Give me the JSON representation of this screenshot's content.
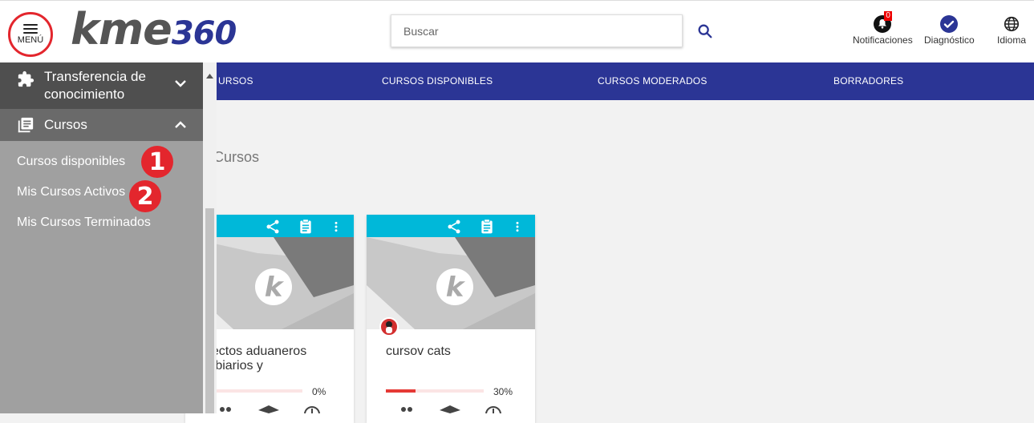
{
  "header": {
    "menu_label": "MENÚ",
    "logo_kme": "kme",
    "logo_360": "360",
    "search_placeholder": "Buscar",
    "notifications_label": "Notificaciones",
    "notifications_count": "0",
    "diagnostic_label": "Diagnóstico",
    "language_label": "Idioma"
  },
  "nav": {
    "tabs": [
      "URSOS",
      "CURSOS DISPONIBLES",
      "CURSOS MODERADOS",
      "BORRADORES"
    ]
  },
  "sidebar": {
    "group1_label_line1": "Transferencia de",
    "group1_label_line2": "conocimiento",
    "group2_label": "Cursos",
    "items": [
      "Cursos disponibles",
      "Mis Cursos Activos",
      "Mis Cursos Terminados"
    ]
  },
  "annotations": [
    "1",
    "2"
  ],
  "main": {
    "section_title": "Cursos",
    "cards": [
      {
        "title_line1": "pectos aduaneros",
        "title_line2": "mbiarios y",
        "progress": 0,
        "progress_label": "0%"
      },
      {
        "title_line1": "cursov cats",
        "title_line2": "",
        "progress": 30,
        "progress_label": "30%"
      }
    ]
  },
  "colors": {
    "brand_blue": "#2b3595",
    "card_bar": "#00b8d9",
    "accent_red": "#e3262d",
    "sidebar_bg": "#a0a0a0"
  }
}
